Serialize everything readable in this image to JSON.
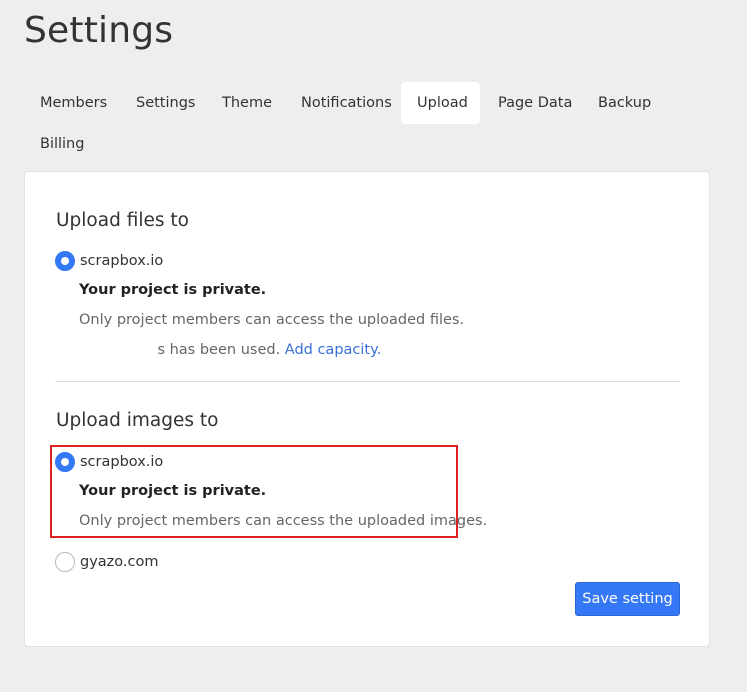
{
  "page": {
    "title": "Settings"
  },
  "tabs": [
    {
      "label": "Members"
    },
    {
      "label": "Settings"
    },
    {
      "label": "Theme"
    },
    {
      "label": "Notifications"
    },
    {
      "label": "Upload",
      "active": true
    },
    {
      "label": "Page Data"
    },
    {
      "label": "Backup"
    },
    {
      "label": "Billing"
    }
  ],
  "upload_files": {
    "title": "Upload files to",
    "option_label": "scrapbox.io",
    "selected": true,
    "privacy_heading": "Your project is private.",
    "privacy_text": "Only project members can access the uploaded files.",
    "usage_clipped": "s",
    "usage_text": " has been used. ",
    "add_capacity_link": "Add capacity."
  },
  "upload_images": {
    "title": "Upload images to",
    "options": [
      {
        "label": "scrapbox.io",
        "selected": true,
        "privacy_heading": "Your project is private.",
        "privacy_text": "Only project members can access the uploaded images."
      },
      {
        "label": "gyazo.com",
        "selected": false
      }
    ]
  },
  "save_button": {
    "label": "Save setting"
  },
  "colors": {
    "accent": "#3478f6",
    "link": "#3a6fd8",
    "highlight_border": "#dd2222",
    "background": "#eeeeee"
  }
}
